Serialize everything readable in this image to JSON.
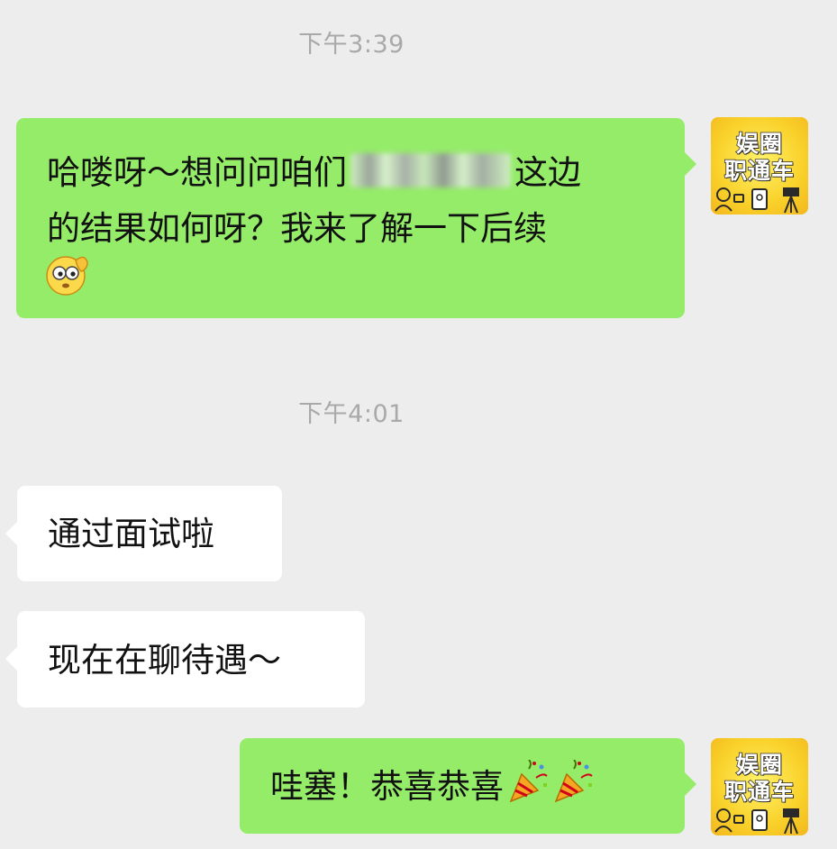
{
  "chat": {
    "messages": [
      {
        "type": "timestamp",
        "text": "下午3:39"
      },
      {
        "type": "sent",
        "line1_before": "哈喽呀～想问问咱们",
        "line1_after": "这边",
        "line2": "的结果如何呀？我来了解一下后续",
        "emoji": "salute-face-emoji"
      },
      {
        "type": "timestamp",
        "text": "下午4:01"
      },
      {
        "type": "received",
        "text": "通过面试啦"
      },
      {
        "type": "received",
        "text": "现在在聊待遇～"
      },
      {
        "type": "sent",
        "text": "哇塞！恭喜恭喜",
        "emoji": "party-popper-emoji"
      }
    ]
  },
  "avatar": {
    "line1": "娱圈",
    "line2": "职通车",
    "background": "#f9d12a"
  },
  "colors": {
    "background": "#ededed",
    "sent_bubble": "#95ec69",
    "received_bubble": "#ffffff",
    "timestamp": "#a9a9a9"
  }
}
